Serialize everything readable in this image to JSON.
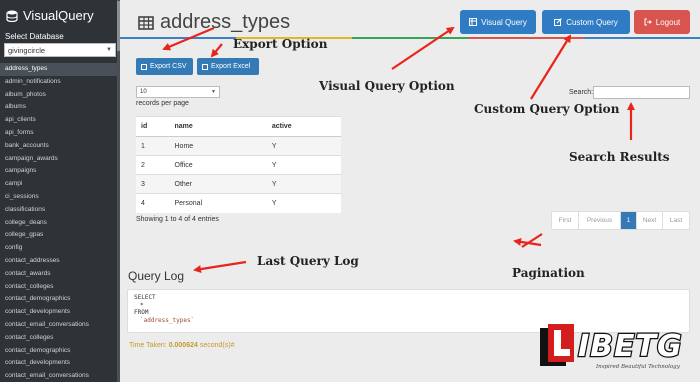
{
  "app": {
    "name": "VisualQuery"
  },
  "sidebar": {
    "db_label": "Select Database",
    "db_value": "givingcircle",
    "tables": [
      "address_types",
      "admin_notifications",
      "album_photos",
      "albums",
      "api_clients",
      "api_forms",
      "bank_accounts",
      "campaign_awards",
      "campaigns",
      "campi",
      "ci_sessions",
      "classifications",
      "college_deans",
      "college_gpas",
      "config",
      "contact_addresses",
      "contact_awards",
      "contact_colleges",
      "contact_demographics",
      "contact_developments",
      "contact_email_conversations",
      "contact_colleges",
      "contact_demographics",
      "contact_developments",
      "contact_email_conversations"
    ],
    "active_index": 0
  },
  "header": {
    "title": "address_types",
    "visual_query": "Visual Query",
    "custom_query": "Custom Query",
    "logout": "Logout",
    "bar_colors": [
      "#3b7fc4",
      "#e3b626",
      "#3aa35a",
      "#d9534f",
      "#3b7fc4"
    ]
  },
  "toolbar": {
    "export_csv": "Export CSV",
    "export_excel": "Export Excel"
  },
  "table_controls": {
    "length_value": "10",
    "length_label": "records per page",
    "search_label": "Search:"
  },
  "table": {
    "columns": [
      "id",
      "name",
      "active"
    ],
    "rows": [
      [
        "1",
        "Home",
        "Y"
      ],
      [
        "2",
        "Office",
        "Y"
      ],
      [
        "3",
        "Other",
        "Y"
      ],
      [
        "4",
        "Personal",
        "Y"
      ]
    ]
  },
  "footer": {
    "info": "Showing 1 to 4 of 4 entries"
  },
  "pagination": {
    "first": "First",
    "previous": "Previous",
    "current": "1",
    "next": "Next",
    "last": "Last"
  },
  "query_log": {
    "title": "Query Log",
    "lines": [
      "SELECT",
      "*",
      "FROM",
      "`address_types`"
    ],
    "time_label": "Time Taken: ",
    "time_value": "0.000624",
    "time_unit": " second(s)#"
  },
  "annotations": {
    "export": "Export Option",
    "visual": "Visual Query Option",
    "custom": "Custom Query Option",
    "search": "Search Results",
    "last_query": "Last Query Log",
    "pagination": "Pagination"
  },
  "watermark": {
    "text": "IBETG",
    "tagline": "Inspired Beautiful Technology"
  },
  "colors": {
    "primary": "#337ab7",
    "danger": "#d9534f",
    "sidebar": "#2e3338",
    "annotation_arrow": "#e8241c"
  }
}
